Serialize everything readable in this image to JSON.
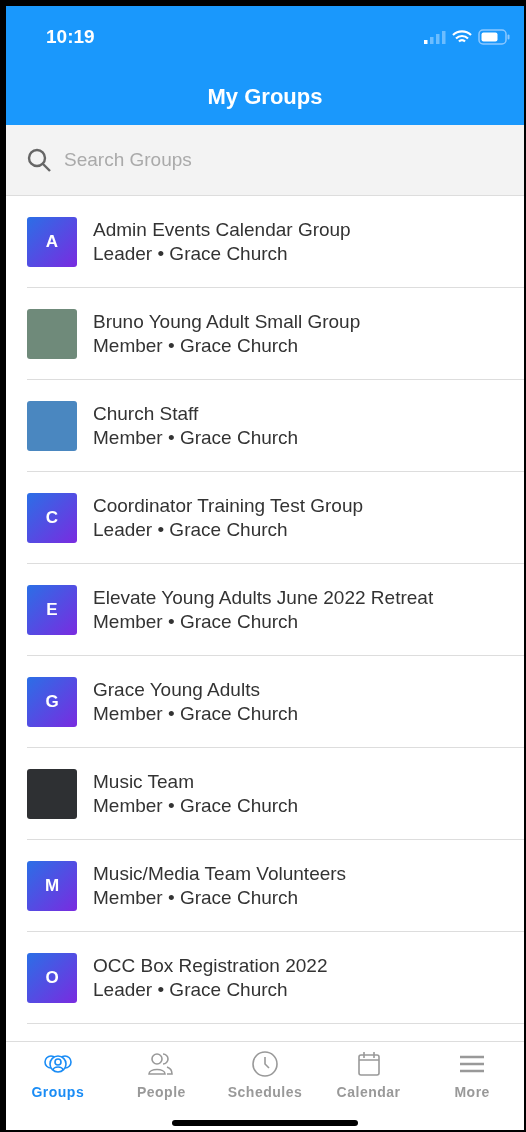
{
  "status_bar": {
    "time": "10:19"
  },
  "header": {
    "title": "My Groups"
  },
  "search": {
    "placeholder": "Search Groups"
  },
  "groups": [
    {
      "kind": "letter",
      "letter": "A",
      "name": "Admin Events Calendar Group",
      "subtitle": "Leader • Grace Church"
    },
    {
      "kind": "image",
      "color": "#6f8a7a",
      "name": "Bruno Young Adult Small Group",
      "subtitle": "Member • Grace Church"
    },
    {
      "kind": "image",
      "color": "#4a87c0",
      "name": "Church Staff",
      "subtitle": "Member • Grace Church"
    },
    {
      "kind": "letter",
      "letter": "C",
      "name": "Coordinator Training Test Group",
      "subtitle": "Leader • Grace Church"
    },
    {
      "kind": "letter",
      "letter": "E",
      "name": "Elevate Young Adults June 2022 Retreat",
      "subtitle": "Member • Grace Church"
    },
    {
      "kind": "letter",
      "letter": "G",
      "name": "Grace Young Adults",
      "subtitle": "Member • Grace Church"
    },
    {
      "kind": "image",
      "color": "#2e3033",
      "name": "Music Team",
      "subtitle": "Member • Grace Church"
    },
    {
      "kind": "letter",
      "letter": "M",
      "name": "Music/Media Team Volunteers",
      "subtitle": "Member • Grace Church"
    },
    {
      "kind": "letter",
      "letter": "O",
      "name": "OCC Box Registration 2022",
      "subtitle": "Leader • Grace Church"
    }
  ],
  "tabs": [
    {
      "label": "Groups",
      "selected": true
    },
    {
      "label": "People",
      "selected": false
    },
    {
      "label": "Schedules",
      "selected": false
    },
    {
      "label": "Calendar",
      "selected": false
    },
    {
      "label": "More",
      "selected": false
    }
  ]
}
